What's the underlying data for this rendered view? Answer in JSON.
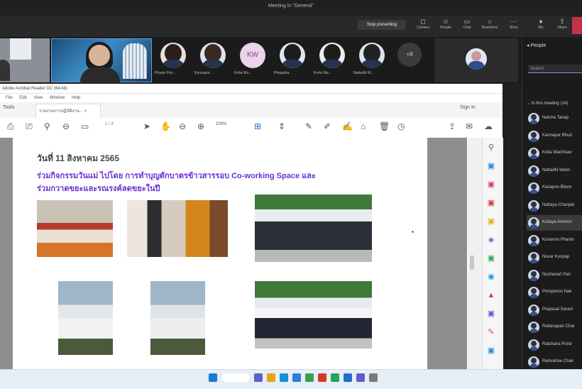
{
  "meeting": {
    "title": "Meeting in \"General\"",
    "stop_presenting_label": "Stop presenting",
    "toolbar_buttons": [
      {
        "label": "Camera",
        "icon": "camera-icon"
      },
      {
        "label": "People",
        "icon": "people-icon"
      },
      {
        "label": "Chat",
        "icon": "chat-icon"
      },
      {
        "label": "Reactions",
        "icon": "reactions-icon"
      },
      {
        "label": "More",
        "icon": "more-icon"
      },
      {
        "label": "Mic",
        "icon": "mic-icon"
      },
      {
        "label": "Share",
        "icon": "share-icon"
      }
    ],
    "participants_strip": [
      {
        "name": "Phasin Pen...",
        "initials": ""
      },
      {
        "name": "Kannapor...",
        "initials": ""
      },
      {
        "name": "Kotla Wa...",
        "initials": "KW"
      },
      {
        "name": "Phigapha...",
        "initials": ""
      },
      {
        "name": "Korta Wa...",
        "initials": ""
      },
      {
        "name": "Nattadhi W...",
        "initials": ""
      }
    ],
    "more_count": "+8"
  },
  "people_pane": {
    "header": "People",
    "search_placeholder": "Search",
    "section_label": "In this meeting (14)",
    "people": [
      {
        "name": "Natcha Tanap"
      },
      {
        "name": "Kannapor Bhud"
      },
      {
        "name": "Kotla Wachiraw"
      },
      {
        "name": "Nattadhi Wann"
      },
      {
        "name": "Kanapon Bhum"
      },
      {
        "name": "Nattaya Chanpat"
      },
      {
        "name": "Kullaya Ammon"
      },
      {
        "name": "Kunanon Phanto"
      },
      {
        "name": "Nuvar Kunpap"
      },
      {
        "name": "Nuchanart Pan"
      },
      {
        "name": "Pornpimon Nak"
      },
      {
        "name": "Prapasat Sarani"
      },
      {
        "name": "Rattanapan Chal"
      },
      {
        "name": "Ratchana Pond"
      },
      {
        "name": "Ramratree Chan"
      }
    ]
  },
  "acrobat": {
    "window_title": "Adobe Acrobat Reader DC (64-bit)",
    "menu": [
      "File",
      "Edit",
      "View",
      "Window",
      "Help"
    ],
    "home_tab": "Tools",
    "doc_tab": "รายงานการปฏิบัติงาน... ×",
    "sign_in": "Sign In",
    "page_indicator": "1 / 3",
    "zoom": "100%"
  },
  "document": {
    "date_heading": "วันที่ 11 สิงหาคม 2565",
    "line1": "ร่วมกิจกรรมวันแม่ ไปโดย การทำบุญตักบาตรข้าวสารรอบ Co-working Space และ",
    "line2": "ร่วมกวาดขยะและรณรงค์ลดขยะในปี"
  },
  "colors": {
    "accent_purple": "#6a2fd0",
    "teams_bg": "#1f1f1f",
    "leave_red": "#c4314b"
  }
}
